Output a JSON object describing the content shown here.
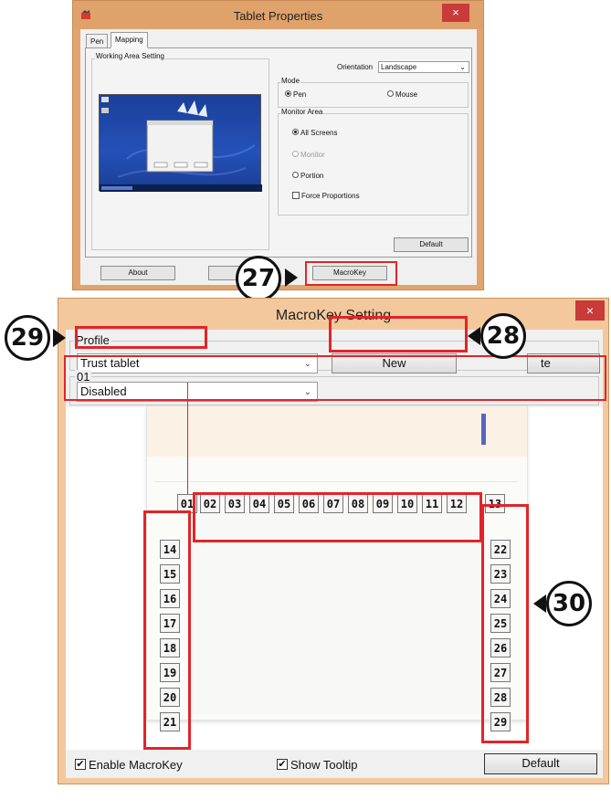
{
  "tablet_properties": {
    "title": "Tablet Properties",
    "close_glyph": "×",
    "tabs": [
      "Pen",
      "Mapping"
    ],
    "working_area_label": "Working Area Setting",
    "orientation_label": "Orientation",
    "orientation_value": "Landscape",
    "mode_label": "Mode",
    "mode_pen": "Pen",
    "mode_mouse": "Mouse",
    "monitor_area_label": "Monitor Area",
    "all_screens": "All Screens",
    "monitor": "Monitor",
    "portion": "Portion",
    "force_proportions": "Force Proportions",
    "default_button": "Default",
    "about_button": "About",
    "macrokey_button": "MacroKey"
  },
  "callouts": {
    "c27": "27",
    "c28": "28",
    "c29": "29",
    "c30": "30"
  },
  "macrokey": {
    "title": "MacroKey Setting",
    "close_glyph": "×",
    "profile_label": "Profile",
    "profile_value": "Trust tablet",
    "new_button": "New",
    "delete_button_partial": "te",
    "key_label": "01",
    "action_value": "Disabled",
    "top_keys": [
      "01",
      "02",
      "03",
      "04",
      "05",
      "06",
      "07",
      "08",
      "09",
      "10",
      "11",
      "12",
      "13"
    ],
    "left_keys": [
      "14",
      "15",
      "16",
      "17",
      "18",
      "19",
      "20",
      "21"
    ],
    "right_keys": [
      "22",
      "23",
      "24",
      "25",
      "26",
      "27",
      "28",
      "29"
    ],
    "enable_macrokey": "Enable MacroKey",
    "show_tooltip": "Show Tooltip",
    "default_button": "Default"
  },
  "colors": {
    "highlight": "#e0252a",
    "window_frame": "#f4c89d",
    "title_close": "#c93a3a"
  }
}
